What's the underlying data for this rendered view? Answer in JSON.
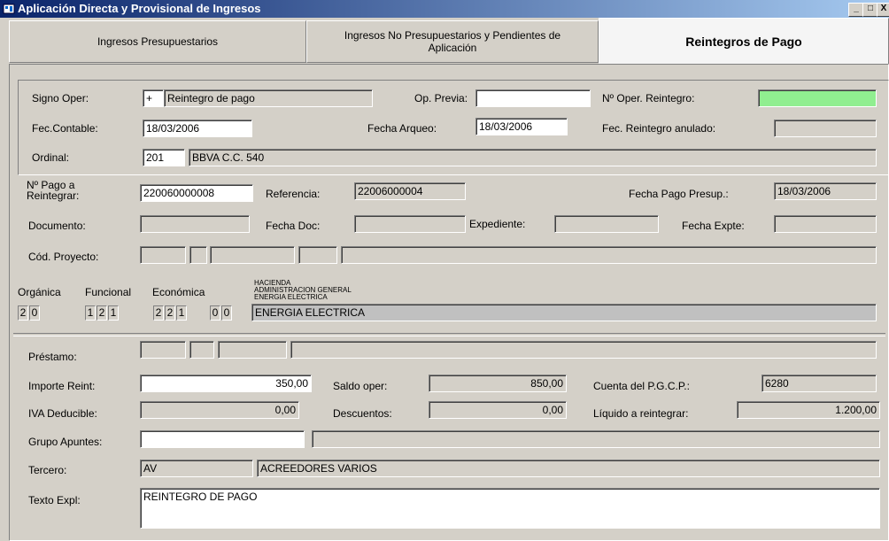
{
  "window": {
    "title": "Aplicación Directa y Provisional de Ingresos",
    "min": "_",
    "max": "□",
    "close": "X"
  },
  "tabs": [
    {
      "label": "Ingresos Presupuestarios"
    },
    {
      "label": "Ingresos No Presupuestarios y Pendientes de Aplicación"
    },
    {
      "label": "Reintegros de Pago"
    }
  ],
  "oper": {
    "signo_label": "Signo Oper:",
    "signo_sign": "+",
    "signo_value": "Reintegro de pago",
    "op_previa_label": "Op. Previa:",
    "op_previa_value": "",
    "num_oper_label": "Nº Oper. Reintegro:",
    "num_oper_value": "",
    "fec_contable_label": "Fec.Contable:",
    "fec_contable_value": "18/03/2006",
    "fecha_arqueo_label": "Fecha Arqueo:",
    "fecha_arqueo_value": "18/03/2006",
    "fec_reintegro_anulado_label": "Fec. Reintegro anulado:",
    "fec_reintegro_anulado_value": "",
    "ordinal_label": "Ordinal:",
    "ordinal_code": "201",
    "ordinal_desc": "BBVA C.C. 540"
  },
  "pago": {
    "num_pago_label": "Nº Pago a Reintegrar:",
    "num_pago_value": "220060000008",
    "referencia_label": "Referencia:",
    "referencia_value": "22006000004",
    "fecha_pago_presup_label": "Fecha Pago Presup.:",
    "fecha_pago_presup_value": "18/03/2006",
    "documento_label": "Documento:",
    "documento_value": "",
    "fecha_doc_label": "Fecha Doc:",
    "fecha_doc_value": "",
    "expediente_label": "Expediente:",
    "expediente_value": "",
    "fecha_expte_label": "Fecha Expte:",
    "fecha_expte_value": "",
    "cod_proyecto_label": "Cód. Proyecto:"
  },
  "clasif": {
    "organica_label": "Orgánica",
    "funcional_label": "Funcional",
    "economica_label": "Económica",
    "organica_digits": [
      "2",
      "0"
    ],
    "funcional_digits": [
      "1",
      "2",
      "1"
    ],
    "economica_digits": [
      "2",
      "2",
      "1"
    ],
    "sub_digits": [
      "0",
      "0"
    ],
    "desc_line1": "HACIENDA",
    "desc_line2": "ADMINISTRACION GENERAL",
    "desc_line3": "ENERGIA ELECTRICA",
    "desc_value": "ENERGIA ELECTRICA"
  },
  "importes": {
    "prestamo_label": "Préstamo:",
    "importe_reint_label": "Importe Reint:",
    "importe_reint_value": "350,00",
    "saldo_oper_label": "Saldo oper:",
    "saldo_oper_value": "850,00",
    "cuenta_pgcp_label": "Cuenta del P.G.C.P.:",
    "cuenta_pgcp_value": "6280",
    "iva_label": "IVA Deducible:",
    "iva_value": "0,00",
    "descuentos_label": "Descuentos:",
    "descuentos_value": "0,00",
    "liquido_label": "Líquido a reintegrar:",
    "liquido_value": "1.200,00",
    "grupo_label": "Grupo Apuntes:",
    "grupo_value": "",
    "tercero_label": "Tercero:",
    "tercero_code": "AV",
    "tercero_desc": "ACREEDORES VARIOS",
    "texto_label": "Texto Expl:",
    "texto_value": "REINTEGRO DE PAGO"
  }
}
